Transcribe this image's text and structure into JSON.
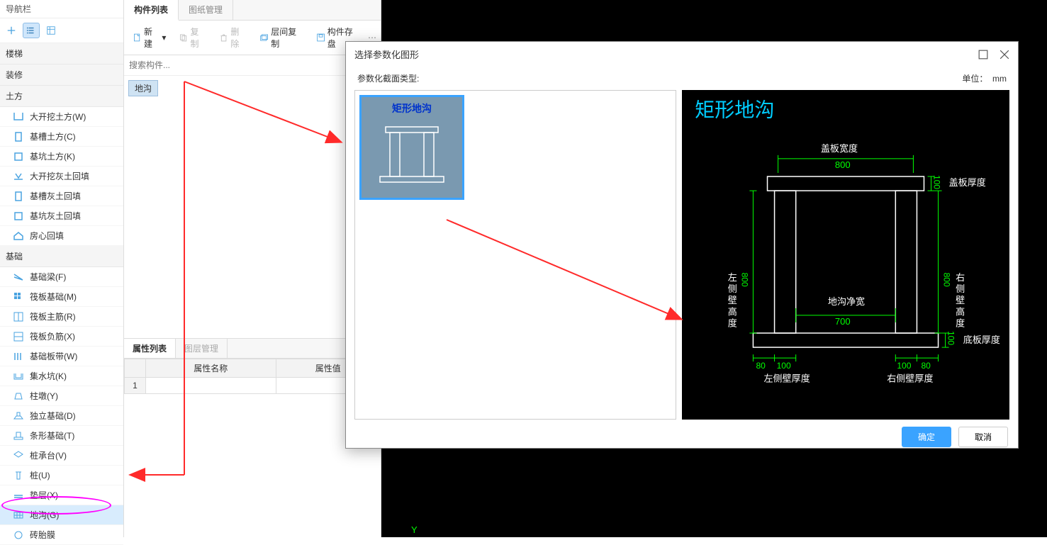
{
  "sidebar": {
    "title": "导航栏",
    "categories": [
      {
        "name": "楼梯",
        "items": []
      },
      {
        "name": "装修",
        "items": []
      },
      {
        "name": "土方",
        "items": [
          {
            "label": "大开挖土方(W)"
          },
          {
            "label": "基槽土方(C)"
          },
          {
            "label": "基坑土方(K)"
          },
          {
            "label": "大开挖灰土回填"
          },
          {
            "label": "基槽灰土回填"
          },
          {
            "label": "基坑灰土回填"
          },
          {
            "label": "房心回填"
          }
        ]
      },
      {
        "name": "基础",
        "items": [
          {
            "label": "基础梁(F)"
          },
          {
            "label": "筏板基础(M)"
          },
          {
            "label": "筏板主筋(R)"
          },
          {
            "label": "筏板负筋(X)"
          },
          {
            "label": "基础板带(W)"
          },
          {
            "label": "集水坑(K)"
          },
          {
            "label": "柱墩(Y)"
          },
          {
            "label": "独立基础(D)"
          },
          {
            "label": "条形基础(T)"
          },
          {
            "label": "桩承台(V)"
          },
          {
            "label": "桩(U)"
          },
          {
            "label": "垫层(X)"
          },
          {
            "label": "地沟(G)",
            "selected": true
          },
          {
            "label": "砖胎膜"
          }
        ]
      }
    ]
  },
  "mid": {
    "tabs": {
      "t1": "构件列表",
      "t2": "图纸管理"
    },
    "toolbar": {
      "new": "新建",
      "copy": "复制",
      "delete": "删除",
      "layer_copy": "层间复制",
      "save_comp": "构件存盘"
    },
    "search_placeholder": "搜索构件...",
    "tag": "地沟",
    "prop": {
      "tab1": "属性列表",
      "tab2": "图层管理",
      "col1": "属性名称",
      "col2": "属性值",
      "row1": "1"
    }
  },
  "dialog": {
    "title": "选择参数化图形",
    "label_type": "参数化截面类型:",
    "label_unit": "单位：",
    "unit_val": "mm",
    "card_title": "矩形地沟",
    "ok": "确定",
    "cancel": "取消",
    "preview": {
      "title": "矩形地沟",
      "cover_width_label": "盖板宽度",
      "cover_width": "800",
      "cover_thick_label": "盖板厚度",
      "cover_thick": "100",
      "left_wall_h_label": "左侧壁高度",
      "left_wall_h": "800",
      "right_wall_h_label": "右侧壁高度",
      "right_wall_h": "800",
      "net_width_label": "地沟净宽",
      "net_width": "700",
      "bottom_thick_label": "底板厚度",
      "bottom_thick": "100",
      "left_wall_t_label": "左侧壁厚度",
      "left_wall_t1": "80",
      "left_wall_t2": "100",
      "right_wall_t_label": "右侧壁厚度",
      "right_wall_t1": "100",
      "right_wall_t2": "80"
    }
  },
  "canvas": {
    "y_label": "Y"
  }
}
